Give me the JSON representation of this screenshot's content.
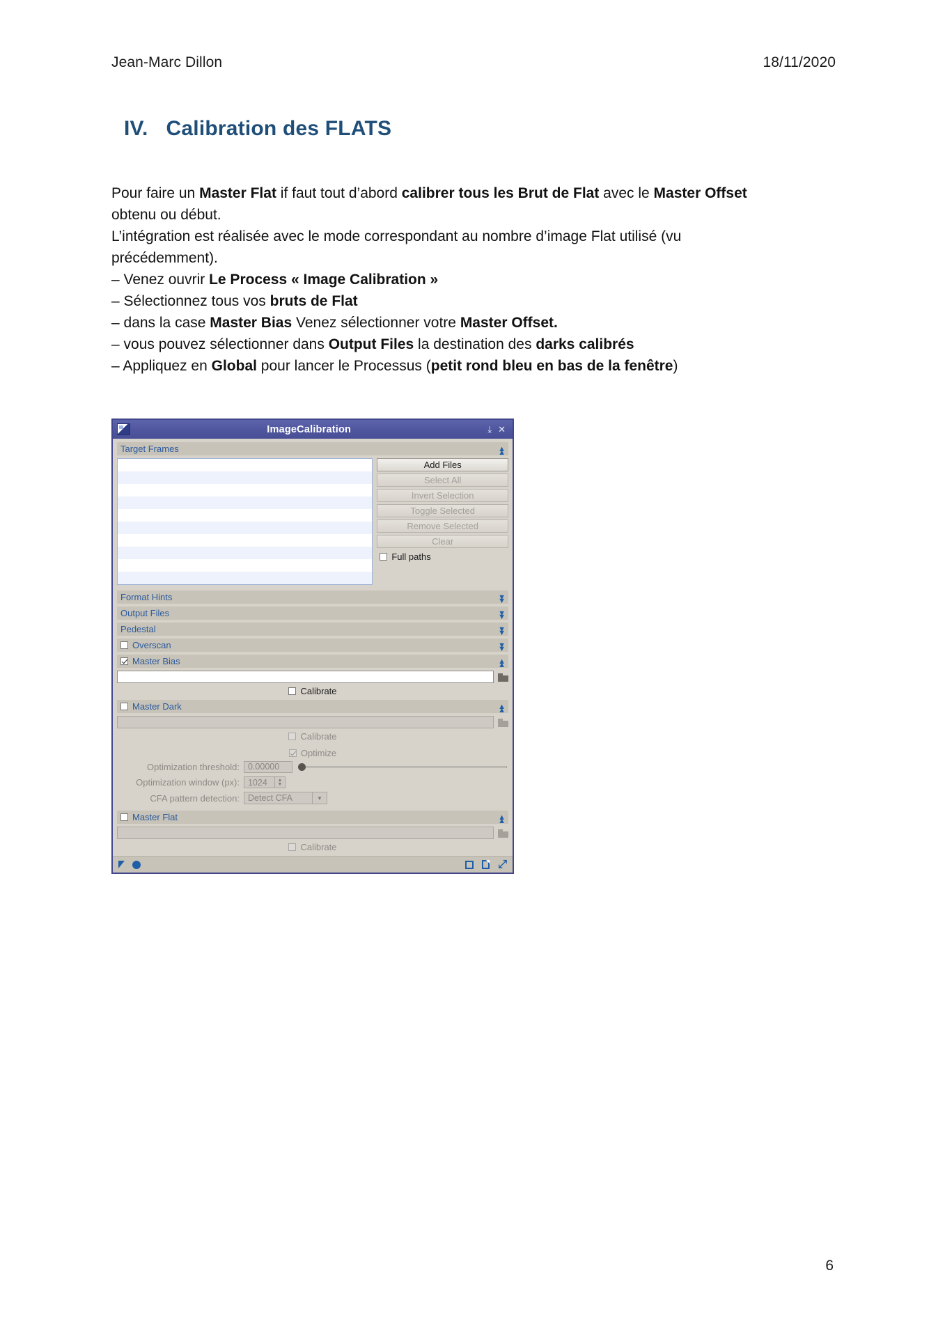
{
  "document": {
    "header": {
      "author": "Jean-Marc Dillon",
      "date": "18/11/2020"
    },
    "heading": {
      "numeral": "IV.",
      "text": "Calibration des FLATS"
    },
    "paragraphs": {
      "p1_a": "Pour faire un ",
      "p1_b1": "Master Flat",
      "p1_c": " if faut tout d’abord ",
      "p1_b2": "calibrer tous les Brut de Flat",
      "p1_d": " avec le ",
      "p1_b3": "Master Offset",
      "p1_e": " obtenu ou début.",
      "p2": "L’intégration est réalisée avec le mode correspondant au nombre d’image Flat utilisé (vu précédemment)."
    },
    "list": {
      "i1_a": "– Venez ouvrir ",
      "i1_b": "Le Process « Image Calibration »",
      "i2_a": "– Sélectionnez tous vos ",
      "i2_b": "bruts de  Flat",
      "i3_a": "– dans la case ",
      "i3_b": "Master Bias",
      "i3_c": " Venez sélectionner votre ",
      "i3_d": "Master Offset.",
      "i4_a": "– vous pouvez sélectionner dans ",
      "i4_b": "Output Files",
      "i4_c": " la destination des ",
      "i4_d": "darks calibrés",
      "i5_a": "– Appliquez en ",
      "i5_b": "Global",
      "i5_c": " pour lancer le Processus (",
      "i5_d": "petit rond bleu en bas de la fenêtre",
      "i5_e": ")"
    },
    "page_number": "6"
  },
  "dialog": {
    "title": "ImageCalibration",
    "titlebar_buttons": {
      "pin": "✕",
      "pin_icon": "⤒",
      "close": "✕"
    },
    "target_frames": {
      "section_label": "Target Frames",
      "buttons": [
        {
          "label": "Add Files",
          "enabled": true
        },
        {
          "label": "Select All",
          "enabled": false
        },
        {
          "label": "Invert Selection",
          "enabled": false
        },
        {
          "label": "Toggle Selected",
          "enabled": false
        },
        {
          "label": "Remove Selected",
          "enabled": false
        },
        {
          "label": "Clear",
          "enabled": false
        }
      ],
      "full_paths_label": "Full paths",
      "full_paths_checked": false
    },
    "sections": [
      {
        "label": "Format Hints",
        "collapsed": true,
        "has_checkbox": false
      },
      {
        "label": "Output Files",
        "collapsed": true,
        "has_checkbox": false
      },
      {
        "label": "Pedestal",
        "collapsed": true,
        "has_checkbox": false
      },
      {
        "label": "Overscan",
        "collapsed": true,
        "has_checkbox": true,
        "checked": false
      }
    ],
    "master_bias": {
      "label": "Master Bias",
      "checked": true,
      "path_value": "",
      "calibrate_label": "Calibrate",
      "calibrate_checked": false
    },
    "master_dark": {
      "label": "Master Dark",
      "checked": false,
      "path_value": "",
      "calibrate_label": "Calibrate",
      "calibrate_checked": false,
      "optimize_label": "Optimize",
      "optimize_checked": true,
      "threshold_label": "Optimization threshold:",
      "threshold_value": "0.00000",
      "window_label": "Optimization window (px):",
      "window_value": "1024",
      "cfa_label": "CFA pattern detection:",
      "cfa_value": "Detect CFA"
    },
    "master_flat": {
      "label": "Master Flat",
      "checked": false,
      "path_value": "",
      "calibrate_label": "Calibrate",
      "calibrate_checked": false
    },
    "footer": {
      "apply_global_icon": "apply-global",
      "icons": [
        "arrow",
        "circle",
        "square",
        "document",
        "reset"
      ]
    },
    "colors": {
      "titlebar": "#4f569e",
      "section_bar": "#c8c3b8",
      "section_text": "#2a5a9e",
      "accent_blue": "#1f5fa8",
      "heading_blue": "#1f4e79"
    }
  }
}
